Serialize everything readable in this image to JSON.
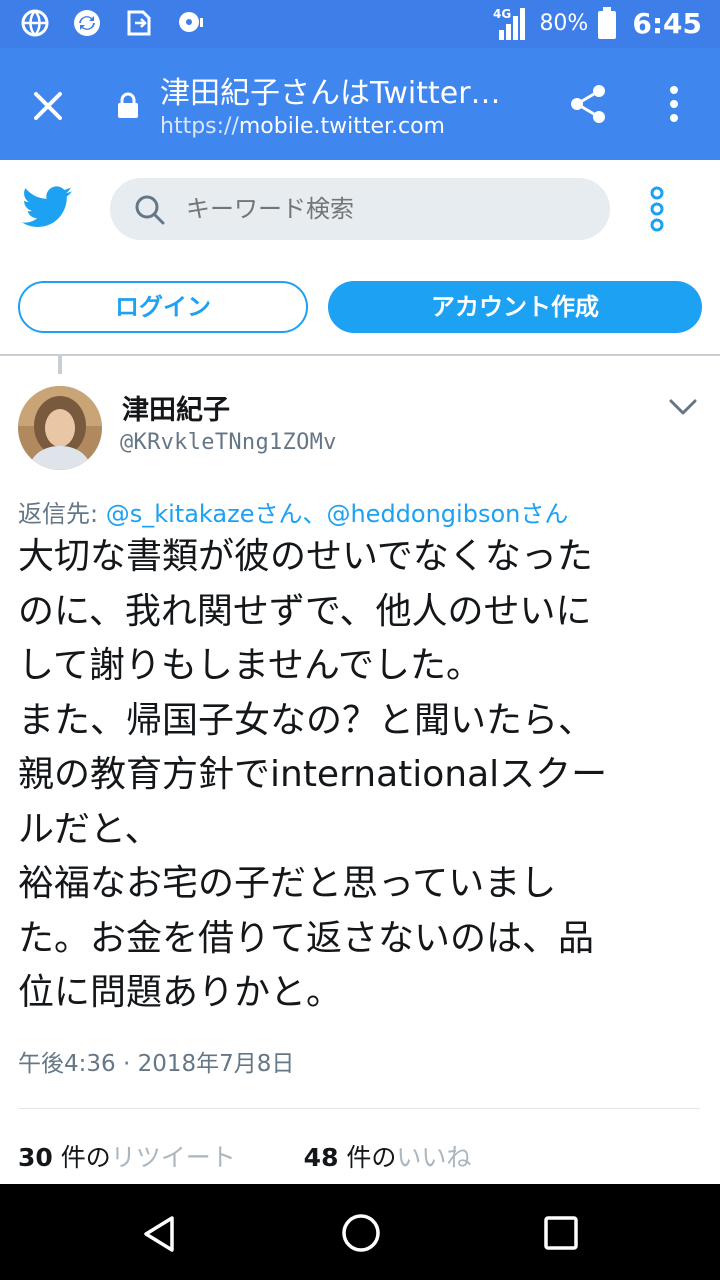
{
  "status_bar": {
    "network": "4G",
    "battery": "80%",
    "time": "6:45"
  },
  "browser": {
    "title": "津田紀子さんはTwitter…",
    "url_protocol": "https://",
    "url_host": "mobile.twitter.com"
  },
  "header": {
    "search_placeholder": "キーワード検索",
    "login_label": "ログイン",
    "signup_label": "アカウント作成"
  },
  "tweet": {
    "display_name": "津田紀子",
    "handle": "@KRvkleTNng1ZOMv",
    "reply_prefix": "返信先:",
    "reply_mentions": "@s_kitakazeさん、@heddongibsonさん",
    "lines": [
      "大切な書類が彼のせいでなくなった",
      "のに、我れ関せずで、他人のせいに",
      "して謝りもしませんでした。",
      "また、帰国子女なの？と聞いたら、",
      "親の教育方針でinternationalスクー",
      "ルだと、",
      "裕福なお宅の子だと思っていまし",
      "た。お金を借りて返さないのは、品",
      "位に問題ありかと。"
    ],
    "timestamp": "午後4:36 · 2018年7月8日",
    "retweet_count": "30",
    "retweet_label_prefix": " 件の",
    "retweet_label": "リツイート",
    "like_count": "48",
    "like_label_prefix": " 件の",
    "like_label": "いいね"
  },
  "colors": {
    "browser_blue": "#3f86ee",
    "twitter_blue": "#1da1f2"
  }
}
